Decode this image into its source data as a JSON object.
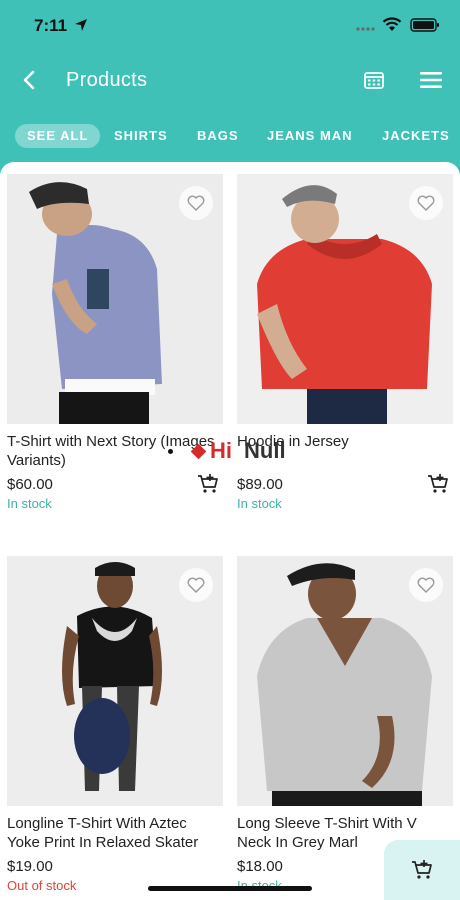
{
  "status_bar": {
    "time": "7:11"
  },
  "header": {
    "title": "Products"
  },
  "tabs": [
    {
      "label": "SEE ALL",
      "active": true
    },
    {
      "label": "SHIRTS"
    },
    {
      "label": "BAGS"
    },
    {
      "label": "JEANS MAN"
    },
    {
      "label": "JACKETS"
    }
  ],
  "products": [
    {
      "name": "T-Shirt with Next Story (Images Variants)",
      "price": "$60.00",
      "stock": "In stock"
    },
    {
      "name": "Hoodie in Jersey",
      "price": "$89.00",
      "stock": "In stock"
    },
    {
      "name": "Longline T-Shirt With Aztec Yoke Print In Relaxed Skater",
      "price": "$19.00",
      "stock": "Out of stock"
    },
    {
      "name": "Long Sleeve T-Shirt With V Neck In Grey Marl",
      "price": "$18.00",
      "stock": "In stock"
    }
  ],
  "watermark": {
    "brand": "Hi",
    "text": "Null"
  },
  "colors": {
    "accent": "#3fc1b8",
    "in_stock": "#3bb3a8",
    "out_of_stock": "#e0443a"
  },
  "icons": [
    "back-arrow-icon",
    "calendar-icon",
    "hamburger-menu-icon",
    "heart-icon",
    "add-to-cart-icon"
  ]
}
